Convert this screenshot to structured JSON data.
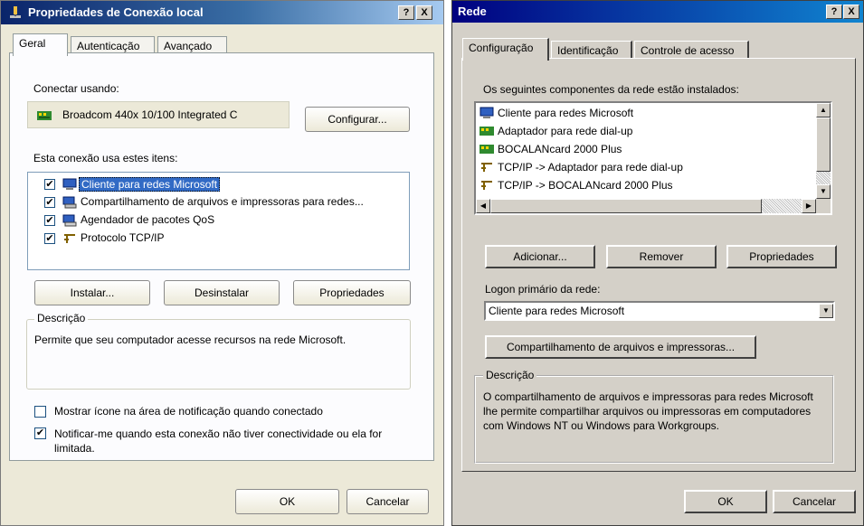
{
  "xp": {
    "title": "Propriedades de Conexão local",
    "help_btn": "?",
    "close_btn": "X",
    "tabs": [
      "Geral",
      "Autenticação",
      "Avançado"
    ],
    "connect_using_label": "Conectar usando:",
    "adapter_name": "Broadcom 440x 10/100 Integrated C",
    "configure_btn": "Configurar...",
    "items_label": "Esta conexão usa estes itens:",
    "items": [
      {
        "label": "Cliente para redes Microsoft",
        "checked": true,
        "icon": "network-client-icon"
      },
      {
        "label": "Compartilhamento de arquivos e impressoras para redes...",
        "checked": true,
        "icon": "file-printer-sharing-icon"
      },
      {
        "label": "Agendador de pacotes QoS",
        "checked": true,
        "icon": "qos-scheduler-icon"
      },
      {
        "label": "Protocolo TCP/IP",
        "checked": true,
        "icon": "protocol-icon"
      }
    ],
    "install_btn": "Instalar...",
    "uninstall_btn": "Desinstalar",
    "properties_btn": "Propriedades",
    "desc_legend": "Descrição",
    "desc_text": "Permite que seu computador acesse recursos na rede Microsoft.",
    "show_icon_label": "Mostrar ícone na área de notificação quando conectado",
    "show_icon_checked": false,
    "notify_label": "Notificar-me quando esta conexão não tiver conectividade ou ela for limitada.",
    "notify_checked": true,
    "ok_btn": "OK",
    "cancel_btn": "Cancelar"
  },
  "w98": {
    "title": "Rede",
    "help_btn": "?",
    "close_btn": "X",
    "tabs": [
      "Configuração",
      "Identificação",
      "Controle de acesso"
    ],
    "components_label": "Os seguintes componentes da rede estão instalados:",
    "components": [
      {
        "label": "Cliente para redes Microsoft",
        "icon": "network-client-icon"
      },
      {
        "label": "Adaptador para rede dial-up",
        "icon": "adapter-icon"
      },
      {
        "label": "BOCALANcard 2000 Plus",
        "icon": "adapter-icon"
      },
      {
        "label": "TCP/IP -> Adaptador para rede dial-up",
        "icon": "protocol-icon"
      },
      {
        "label": "TCP/IP -> BOCALANcard 2000 Plus",
        "icon": "protocol-icon"
      }
    ],
    "add_btn": "Adicionar...",
    "remove_btn": "Remover",
    "properties_btn": "Propriedades",
    "logon_label": "Logon primário da rede:",
    "logon_value": "Cliente para redes Microsoft",
    "sharing_btn": "Compartilhamento de arquivos e impressoras...",
    "desc_legend": "Descrição",
    "desc_text": "O compartilhamento de arquivos e impressoras para redes Microsoft lhe permite compartilhar arquivos ou impressoras em computadores com Windows NT ou Windows para Workgroups.",
    "ok_btn": "OK",
    "cancel_btn": "Cancelar"
  },
  "colors": {
    "xp_title_start": "#0a246a",
    "w98_title_start": "#000080",
    "selection": "#316ac5"
  }
}
